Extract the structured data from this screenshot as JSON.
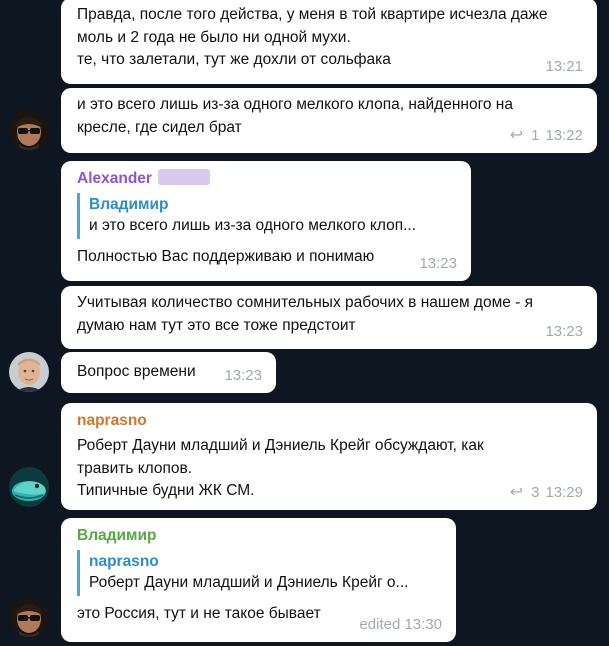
{
  "messages": [
    {
      "text": "Правда, после того действа, у меня в той квартире исчезла даже\nмоль и 2 года не было ни одной мухи.\nте, что залетали, тут же дохли от сольфака",
      "time": "13:21"
    },
    {
      "text": "и это всего лишь из-за одного мелкого клопа, найденного на\nкресле, где сидел брат",
      "replies": "1",
      "time": "13:22"
    },
    {
      "sender": "Alexander",
      "quote_name": "Владимир",
      "quote_text": "и это всего лишь из-за одного мелкого клоп...",
      "text": "Полностью Вас поддерживаю и понимаю",
      "time": "13:23"
    },
    {
      "text": "Учитывая количество сомнительных рабочих в нашем доме - я\nдумаю нам тут это все тоже предстоит",
      "time": "13:23"
    },
    {
      "text": "Вопрос времени",
      "time": "13:23"
    },
    {
      "sender": "naprasno",
      "text": "Роберт Дауни младший и Дэниель Крейг обсуждают, как\nтравить клопов.\nТипичные будни ЖК СМ.",
      "replies": "3",
      "time": "13:29"
    },
    {
      "sender": "Владимир",
      "quote_name": "naprasno",
      "quote_text": "Роберт Дауни младший и Дэниель Крейг о...",
      "text": "это Россия, тут и не такое бывает",
      "time": "edited 13:30"
    }
  ],
  "colors": {
    "background": "#0e1621",
    "bubble": "#ffffff",
    "sender_alexander": "#8e55cc",
    "sender_naprasno": "#d0762e",
    "sender_vladimir": "#55a845",
    "quote_accent": "#4ca5e2",
    "meta": "#a3a9ae"
  },
  "icons": {
    "reply": "reply-arrow-icon"
  }
}
